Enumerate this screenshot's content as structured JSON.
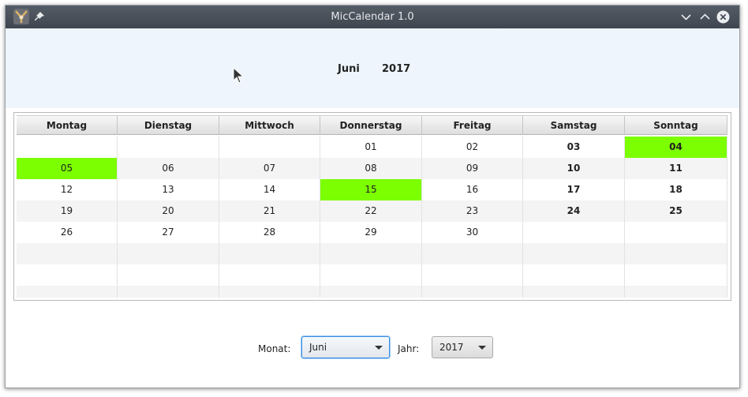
{
  "window": {
    "title": "MicCalendar 1.0"
  },
  "header": {
    "month": "Juni",
    "year": "2017"
  },
  "calendar": {
    "headers": [
      "Montag",
      "Dienstag",
      "Mittwoch",
      "Donnerstag",
      "Freitag",
      "Samstag",
      "Sonntag"
    ],
    "rows": [
      [
        "",
        "",
        "",
        "01",
        "02",
        "03",
        "04"
      ],
      [
        "05",
        "06",
        "07",
        "08",
        "09",
        "10",
        "11"
      ],
      [
        "12",
        "13",
        "14",
        "15",
        "16",
        "17",
        "18"
      ],
      [
        "19",
        "20",
        "21",
        "22",
        "23",
        "24",
        "25"
      ],
      [
        "26",
        "27",
        "28",
        "29",
        "30",
        "",
        ""
      ],
      [
        "",
        "",
        "",
        "",
        "",
        "",
        ""
      ],
      [
        "",
        "",
        "",
        "",
        "",
        "",
        ""
      ],
      [
        "",
        "",
        "",
        "",
        "",
        "",
        ""
      ]
    ],
    "highlighted": [
      "04",
      "05",
      "15"
    ],
    "highlight_color": "#7cff00"
  },
  "controls": {
    "month_label": "Monat:",
    "month_value": "Juni",
    "year_label": "Jahr:",
    "year_value": "2017"
  },
  "icons": {
    "app": "app-icon",
    "pin": "pin-icon",
    "minimize": "chevron-down-icon",
    "maximize": "chevron-up-icon",
    "close": "close-icon"
  }
}
